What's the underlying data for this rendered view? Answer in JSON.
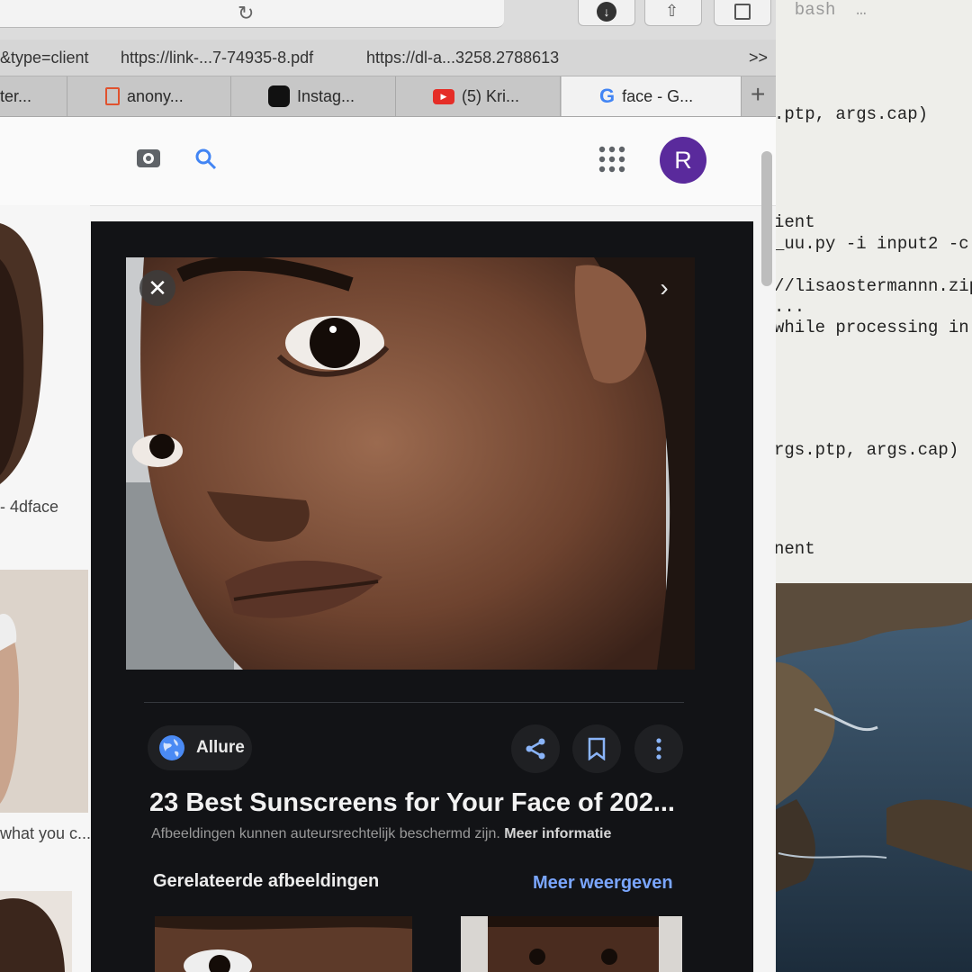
{
  "terminal": {
    "lines": [
      ".ptp, args.cap)",
      "ient",
      "_uu.py -i input2 -c",
      "//lisaostermannn.zip",
      "...",
      "while processing in",
      "rgs.ptp, args.cap)",
      "nent"
    ]
  },
  "bookmarks": {
    "items": [
      "&type=client",
      "https://link-...7-74935-8.pdf",
      "https://dl-a...3258.2788613"
    ],
    "overflow": ">>"
  },
  "tabs": {
    "items": [
      {
        "label": "ter...",
        "icon": "generic"
      },
      {
        "label": "anony...",
        "icon": "pdf-icon"
      },
      {
        "label": "Instag...",
        "icon": "instagram-icon"
      },
      {
        "label": "(5) Kri...",
        "icon": "youtube-icon"
      },
      {
        "label": "face - G...",
        "icon": "google-icon"
      }
    ],
    "new_tab": "+"
  },
  "account": {
    "initial": "R"
  },
  "left_results": {
    "captions": [
      "- 4dface",
      "what you c..."
    ]
  },
  "preview": {
    "close_symbol": "✕",
    "next_symbol": "›",
    "source": "Allure",
    "title": "23 Best Sunscreens for Your Face of 202...",
    "notice": "Afbeeldingen kunnen auteursrechtelijk beschermd zijn.",
    "notice_link": "Meer informatie",
    "related_heading": "Gerelateerde afbeeldingen",
    "more_link": "Meer weergeven"
  },
  "colors": {
    "panel_bg": "#121316",
    "link_blue": "#7aa6ff",
    "avatar_purple": "#5a2a9c",
    "youtube_red": "#e52d27"
  }
}
